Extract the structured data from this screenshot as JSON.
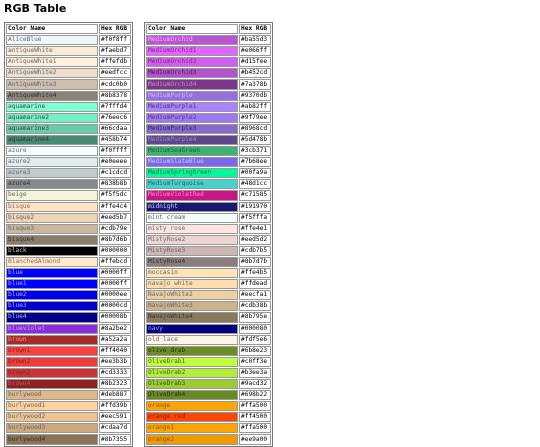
{
  "page": {
    "title": "RGB Table"
  },
  "headers": {
    "name": "Color Name",
    "hex": "Hex RGB"
  },
  "left_rows": [
    {
      "name": "AliceBlue",
      "hex": "#f0f8ff",
      "bg": "#f0f8ff",
      "fg": "#666666"
    },
    {
      "name": "antiqueWhite",
      "hex": "#faebd7",
      "bg": "#faebd7",
      "fg": "#666666"
    },
    {
      "name": "AntiqueWhite1",
      "hex": "#ffefdb",
      "bg": "#ffefdb",
      "fg": "#666666"
    },
    {
      "name": "AntiqueWhite2",
      "hex": "#eedfcc",
      "bg": "#eedfcc",
      "fg": "#666666"
    },
    {
      "name": "AntiqueWhite3",
      "hex": "#cdc0b0",
      "bg": "#cdc0b0",
      "fg": "#666666"
    },
    {
      "name": "AntiqueWhite4",
      "hex": "#8b8378",
      "bg": "#8b8378",
      "fg": "#333333"
    },
    {
      "name": "aquamarine",
      "hex": "#7fffd4",
      "bg": "#7fffd4",
      "fg": "#444444"
    },
    {
      "name": "aquamarine2",
      "hex": "#76eec6",
      "bg": "#76eec6",
      "fg": "#444444"
    },
    {
      "name": "aquamarine3",
      "hex": "#66cdaa",
      "bg": "#66cdaa",
      "fg": "#444444"
    },
    {
      "name": "aquamarine4",
      "hex": "#458b74",
      "bg": "#458b74",
      "fg": "#333333"
    },
    {
      "name": "azure",
      "hex": "#f0ffff",
      "bg": "#f0ffff",
      "fg": "#666666"
    },
    {
      "name": "azure2",
      "hex": "#e0eeee",
      "bg": "#e0eeee",
      "fg": "#666666"
    },
    {
      "name": "azure3",
      "hex": "#c1cdcd",
      "bg": "#c1cdcd",
      "fg": "#666666"
    },
    {
      "name": "azure4",
      "hex": "#838b8b",
      "bg": "#838b8b",
      "fg": "#333333"
    },
    {
      "name": "beige",
      "hex": "#f5f5dc",
      "bg": "#f5f5dc",
      "fg": "#666666"
    },
    {
      "name": "bisque",
      "hex": "#ffe4c4",
      "bg": "#ffe4c4",
      "fg": "#996666"
    },
    {
      "name": "bisque2",
      "hex": "#eed5b7",
      "bg": "#eed5b7",
      "fg": "#666666"
    },
    {
      "name": "bisque3",
      "hex": "#cdb79e",
      "bg": "#cdb79e",
      "fg": "#666666"
    },
    {
      "name": "bisque4",
      "hex": "#8b7d6b",
      "bg": "#8b7d6b",
      "fg": "#333333"
    },
    {
      "name": "black",
      "hex": "#000000",
      "bg": "#000000",
      "fg": "#cccccc"
    },
    {
      "name": "BlanchedAlmond",
      "hex": "#ffebcd",
      "bg": "#ffebcd",
      "fg": "#996666"
    },
    {
      "name": "blue",
      "hex": "#0000ff",
      "bg": "#0000ff",
      "fg": "#aaaaff"
    },
    {
      "name": "blue1",
      "hex": "#0000ff",
      "bg": "#0000ff",
      "fg": "#aaaaff"
    },
    {
      "name": "blue2",
      "hex": "#0000ee",
      "bg": "#0000ee",
      "fg": "#aaaaff"
    },
    {
      "name": "blue3",
      "hex": "#0000cd",
      "bg": "#0000cd",
      "fg": "#aaaaff"
    },
    {
      "name": "blue4",
      "hex": "#00008b",
      "bg": "#00008b",
      "fg": "#aaaaff"
    },
    {
      "name": "blueviolet",
      "hex": "#8a2be2",
      "bg": "#8a2be2",
      "fg": "#cc99ff"
    },
    {
      "name": "brown",
      "hex": "#a52a2a",
      "bg": "#a52a2a",
      "fg": "#ff8888"
    },
    {
      "name": "brown1",
      "hex": "#ff4040",
      "bg": "#ff4040",
      "fg": "#882222"
    },
    {
      "name": "brown2",
      "hex": "#ee3b3b",
      "bg": "#ee3b3b",
      "fg": "#882222"
    },
    {
      "name": "brown3",
      "hex": "#cd3333",
      "bg": "#cd3333",
      "fg": "#882222"
    },
    {
      "name": "brown4",
      "hex": "#8b2323",
      "bg": "#8b2323",
      "fg": "#cc5555"
    },
    {
      "name": "burlywood",
      "hex": "#deb887",
      "bg": "#deb887",
      "fg": "#666666"
    },
    {
      "name": "burlywood1",
      "hex": "#ffd39b",
      "bg": "#ffd39b",
      "fg": "#666666"
    },
    {
      "name": "burlywood2",
      "hex": "#eec591",
      "bg": "#eec591",
      "fg": "#666666"
    },
    {
      "name": "burlywood3",
      "hex": "#cdaa7d",
      "bg": "#cdaa7d",
      "fg": "#666666"
    },
    {
      "name": "burlywood4",
      "hex": "#8b7355",
      "bg": "#8b7355",
      "fg": "#333333"
    }
  ],
  "right_rows": [
    {
      "name": "MediumOrchid",
      "hex": "#ba55d3",
      "bg": "#ba55d3",
      "fg": "#ffaaff"
    },
    {
      "name": "MediumOrchid1",
      "hex": "#e066ff",
      "bg": "#e066ff",
      "fg": "#882288"
    },
    {
      "name": "MediumOrchid2",
      "hex": "#d15fee",
      "bg": "#d15fee",
      "fg": "#882288"
    },
    {
      "name": "MediumOrchid3",
      "hex": "#b452cd",
      "bg": "#b452cd",
      "fg": "#551155"
    },
    {
      "name": "MediumOrchid4",
      "hex": "#7a378b",
      "bg": "#7a378b",
      "fg": "#cc88cc"
    },
    {
      "name": "MediumPurple",
      "hex": "#9370db",
      "bg": "#9370db",
      "fg": "#ccbbff"
    },
    {
      "name": "MediumPurple1",
      "hex": "#ab82ff",
      "bg": "#ab82ff",
      "fg": "#553388"
    },
    {
      "name": "MediumPurple2",
      "hex": "#9f79ee",
      "bg": "#9f79ee",
      "fg": "#553388"
    },
    {
      "name": "MediumPurple3",
      "hex": "#8968cd",
      "bg": "#8968cd",
      "fg": "#332266"
    },
    {
      "name": "MediumPurple4",
      "hex": "#5d478b",
      "bg": "#5d478b",
      "fg": "#9988cc"
    },
    {
      "name": "MediumSeaGreen",
      "hex": "#3cb371",
      "bg": "#3cb371",
      "fg": "#116633"
    },
    {
      "name": "MediumSlateBlue",
      "hex": "#7b68ee",
      "bg": "#7b68ee",
      "fg": "#ccccff"
    },
    {
      "name": "MediumSpringGreen",
      "hex": "#00fa9a",
      "bg": "#00fa9a",
      "fg": "#007744"
    },
    {
      "name": "MediumTurquoise",
      "hex": "#48d1cc",
      "bg": "#48d1cc",
      "fg": "#116666"
    },
    {
      "name": "MediumVioletRed",
      "hex": "#c71585",
      "bg": "#c71585",
      "fg": "#ff88cc"
    },
    {
      "name": "midnight",
      "hex": "#191970",
      "bg": "#191970",
      "fg": "#ccccff"
    },
    {
      "name": "mint cream",
      "hex": "#f5fffa",
      "bg": "#f5fffa",
      "fg": "#666666"
    },
    {
      "name": "misty rose",
      "hex": "#ffe4e1",
      "bg": "#ffe4e1",
      "fg": "#666666"
    },
    {
      "name": "MistyRose2",
      "hex": "#eed5d2",
      "bg": "#eed5d2",
      "fg": "#666666"
    },
    {
      "name": "MistyRose3",
      "hex": "#cdb7b5",
      "bg": "#cdb7b5",
      "fg": "#666666"
    },
    {
      "name": "MistyRose4",
      "hex": "#8b7d7b",
      "bg": "#8b7d7b",
      "fg": "#333333"
    },
    {
      "name": "moccasin",
      "hex": "#ffe4b5",
      "bg": "#ffe4b5",
      "fg": "#666666"
    },
    {
      "name": "navajo white",
      "hex": "#ffdead",
      "bg": "#ffdead",
      "fg": "#666666"
    },
    {
      "name": "NavajoWhite2",
      "hex": "#eecfa1",
      "bg": "#eecfa1",
      "fg": "#666666"
    },
    {
      "name": "NavajoWhite3",
      "hex": "#cdb38b",
      "bg": "#cdb38b",
      "fg": "#666666"
    },
    {
      "name": "NavajoWhite4",
      "hex": "#8b795e",
      "bg": "#8b795e",
      "fg": "#333333"
    },
    {
      "name": "navy",
      "hex": "#000080",
      "bg": "#000080",
      "fg": "#aaaaff"
    },
    {
      "name": "old lace",
      "hex": "#fdf5e6",
      "bg": "#fdf5e6",
      "fg": "#666666"
    },
    {
      "name": "olive drab",
      "hex": "#6b8e23",
      "bg": "#6b8e23",
      "fg": "#223300"
    },
    {
      "name": "OliveDrab1",
      "hex": "#c0ff3e",
      "bg": "#c0ff3e",
      "fg": "#446611"
    },
    {
      "name": "OliveDrab2",
      "hex": "#b3ee3a",
      "bg": "#b3ee3a",
      "fg": "#446611"
    },
    {
      "name": "OliveDrab3",
      "hex": "#9acd32",
      "bg": "#9acd32",
      "fg": "#335511"
    },
    {
      "name": "OliveDrab4",
      "hex": "#698b22",
      "bg": "#698b22",
      "fg": "#223300"
    },
    {
      "name": "orange",
      "hex": "#ffa500",
      "bg": "#ffa500",
      "fg": "#885500"
    },
    {
      "name": "orange red",
      "hex": "#ff4500",
      "bg": "#ff4500",
      "fg": "#882200"
    },
    {
      "name": "orange1",
      "hex": "#ffa500",
      "bg": "#ffa500",
      "fg": "#885500"
    },
    {
      "name": "orange2",
      "hex": "#ee9a00",
      "bg": "#ee9a00",
      "fg": "#885500"
    }
  ]
}
